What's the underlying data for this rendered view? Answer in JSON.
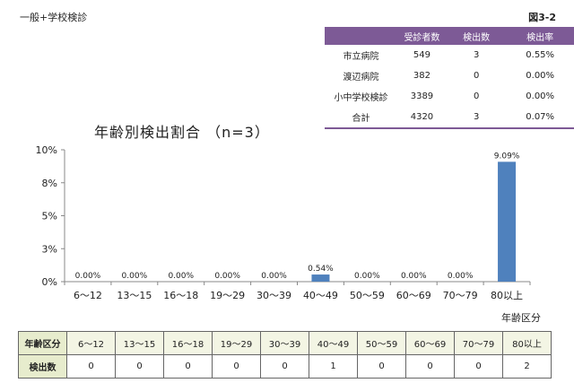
{
  "header": {
    "left_title": "一般+学校検診",
    "figure_label": "図3-2"
  },
  "summary_table": {
    "headers": [
      "",
      "受診者数",
      "検出数",
      "検出率"
    ],
    "rows": [
      [
        "市立病院",
        "549",
        "3",
        "0.55%"
      ],
      [
        "渡辺病院",
        "382",
        "0",
        "0.00%"
      ],
      [
        "小中学校検診",
        "3389",
        "0",
        "0.00%"
      ],
      [
        "合計",
        "4320",
        "3",
        "0.07%"
      ]
    ]
  },
  "chart_data": {
    "type": "bar",
    "title": "年齢別検出割合 （n=3）",
    "xlabel": "年齢区分",
    "ylabel": "",
    "categories": [
      "6～12",
      "13～15",
      "16～18",
      "19～29",
      "30～39",
      "40～49",
      "50～59",
      "60～69",
      "70～79",
      "80以上"
    ],
    "values": [
      0.0,
      0.0,
      0.0,
      0.0,
      0.0,
      0.54,
      0.0,
      0.0,
      0.0,
      9.09
    ],
    "data_labels": [
      "0.00%",
      "0.00%",
      "0.00%",
      "0.00%",
      "0.00%",
      "0.54%",
      "0.00%",
      "0.00%",
      "0.00%",
      "9.09%"
    ],
    "ylim": [
      0,
      10
    ],
    "yticks": [
      0,
      2.5,
      5,
      7.5,
      10
    ],
    "ytick_labels": [
      "0%",
      "3%",
      "5%",
      "8%",
      "10%"
    ],
    "bar_color": "#4f81bd",
    "grid": false
  },
  "bottom_table": {
    "row1_label": "年齢区分",
    "row2_label": "検出数",
    "categories": [
      "6～12",
      "13～15",
      "16～18",
      "19～29",
      "30～39",
      "40～49",
      "50～59",
      "60～69",
      "70～79",
      "80以上"
    ],
    "counts": [
      "0",
      "0",
      "0",
      "0",
      "0",
      "1",
      "0",
      "0",
      "0",
      "2"
    ]
  },
  "colors": {
    "table_header": "#7d5a96",
    "row_head_fill": "#e7eccd",
    "bar": "#4f81bd"
  }
}
